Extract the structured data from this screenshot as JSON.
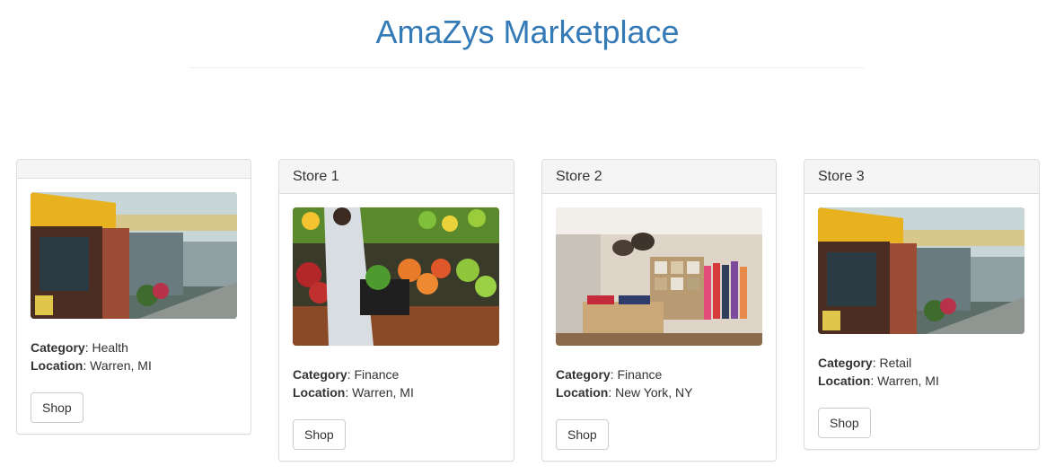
{
  "header": {
    "title": "AmaZys Marketplace"
  },
  "stores": [
    {
      "name": "",
      "category_label": "Category",
      "category": "Health",
      "location_label": "Location",
      "location": "Warren, MI",
      "button": "Shop",
      "image": "art-gallery-storefront"
    },
    {
      "name": "Store 1",
      "category_label": "Category",
      "category": "Finance",
      "location_label": "Location",
      "location": "Warren, MI",
      "button": "Shop",
      "image": "produce-market"
    },
    {
      "name": "Store 2",
      "category_label": "Category",
      "category": "Finance",
      "location_label": "Location",
      "location": "New York, NY",
      "button": "Shop",
      "image": "clothing-boutique"
    },
    {
      "name": "Store 3",
      "category_label": "Category",
      "category": "Retail",
      "location_label": "Location",
      "location": "Warren, MI",
      "button": "Shop",
      "image": "art-gallery-storefront"
    }
  ],
  "colors": {
    "title": "#337ab7",
    "panel_heading_bg": "#f5f5f5",
    "border": "#dddddd"
  }
}
